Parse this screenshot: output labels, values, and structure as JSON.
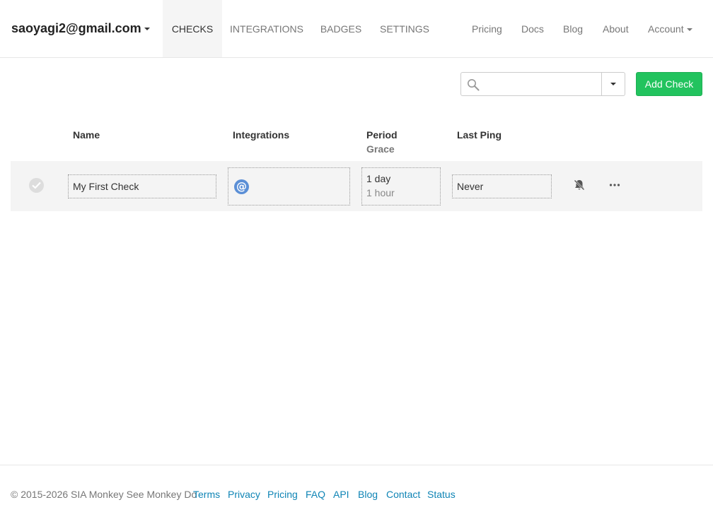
{
  "navbar": {
    "account_email": "saoyagi2@gmail.com",
    "tabs": [
      {
        "label": "CHECKS",
        "active": true
      },
      {
        "label": "INTEGRATIONS",
        "active": false
      },
      {
        "label": "BADGES",
        "active": false
      },
      {
        "label": "SETTINGS",
        "active": false
      }
    ],
    "links": [
      "Pricing",
      "Docs",
      "Blog",
      "About",
      "Account"
    ]
  },
  "toolbar": {
    "search_placeholder": "",
    "search_icon": "search-icon",
    "add_button_label": "Add Check",
    "add_button_color": "#22c35e"
  },
  "table": {
    "headers": {
      "name": "Name",
      "integrations": "Integrations",
      "period": "Period",
      "grace": "Grace",
      "last_ping": "Last Ping"
    },
    "rows": [
      {
        "status": "new",
        "name": "My First Check",
        "integration_icon": "email-icon",
        "integration_glyph": "@",
        "period": "1 day",
        "grace": "1 hour",
        "last_ping": "Never",
        "notifications_icon": "bell-slash-icon",
        "menu_icon": "more-icon"
      }
    ]
  },
  "footer": {
    "copyright": "© 2015-2026 SIA Monkey See Monkey Do",
    "links": [
      "Terms",
      "Privacy",
      "Pricing",
      "FAQ",
      "API",
      "Blog",
      "Contact",
      "Status"
    ],
    "link_color": "#0e84b5"
  }
}
